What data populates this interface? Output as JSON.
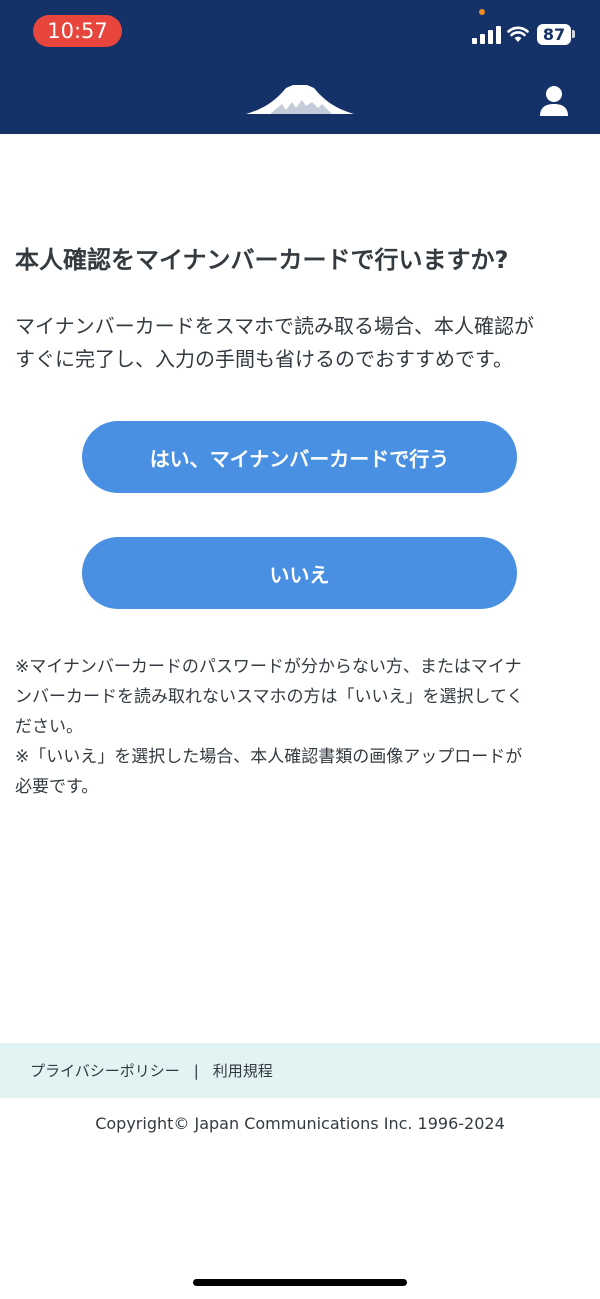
{
  "status_bar": {
    "time": "10:57",
    "battery": "87"
  },
  "header": {
    "logo": "mountain-logo-icon",
    "account": "user-icon"
  },
  "main": {
    "title": "本人確認をマイナンバーカードで行いますか?",
    "lead_line1": "マイナンバーカードをスマホで読み取る場合、本人確認が",
    "lead_line2": "すぐに完了し、入力の手間も省けるのでおすすめです。",
    "yes_button": "はい、マイナンバーカードで行う",
    "no_button": "いいえ",
    "note1_line1": "※マイナンバーカードのパスワードが分からない方、またはマイナ",
    "note1_line2": "ンバーカードを読み取れないスマホの方は「いいえ」を選択してく",
    "note1_line3": "ださい。",
    "note2_line1": "※「いいえ」を選択した場合、本人確認書類の画像アップロードが",
    "note2_line2": "必要です。"
  },
  "footer": {
    "privacy_link": "プライバシーポリシー",
    "separator": "|",
    "terms_link": "利用規程",
    "copyright": "Copyright© Japan Communications Inc. 1996-2024"
  },
  "colors": {
    "header_bg": "#143168",
    "button_bg": "#4a90e2",
    "footer_bg": "#e1f3f3",
    "time_pill": "#e8453c"
  }
}
